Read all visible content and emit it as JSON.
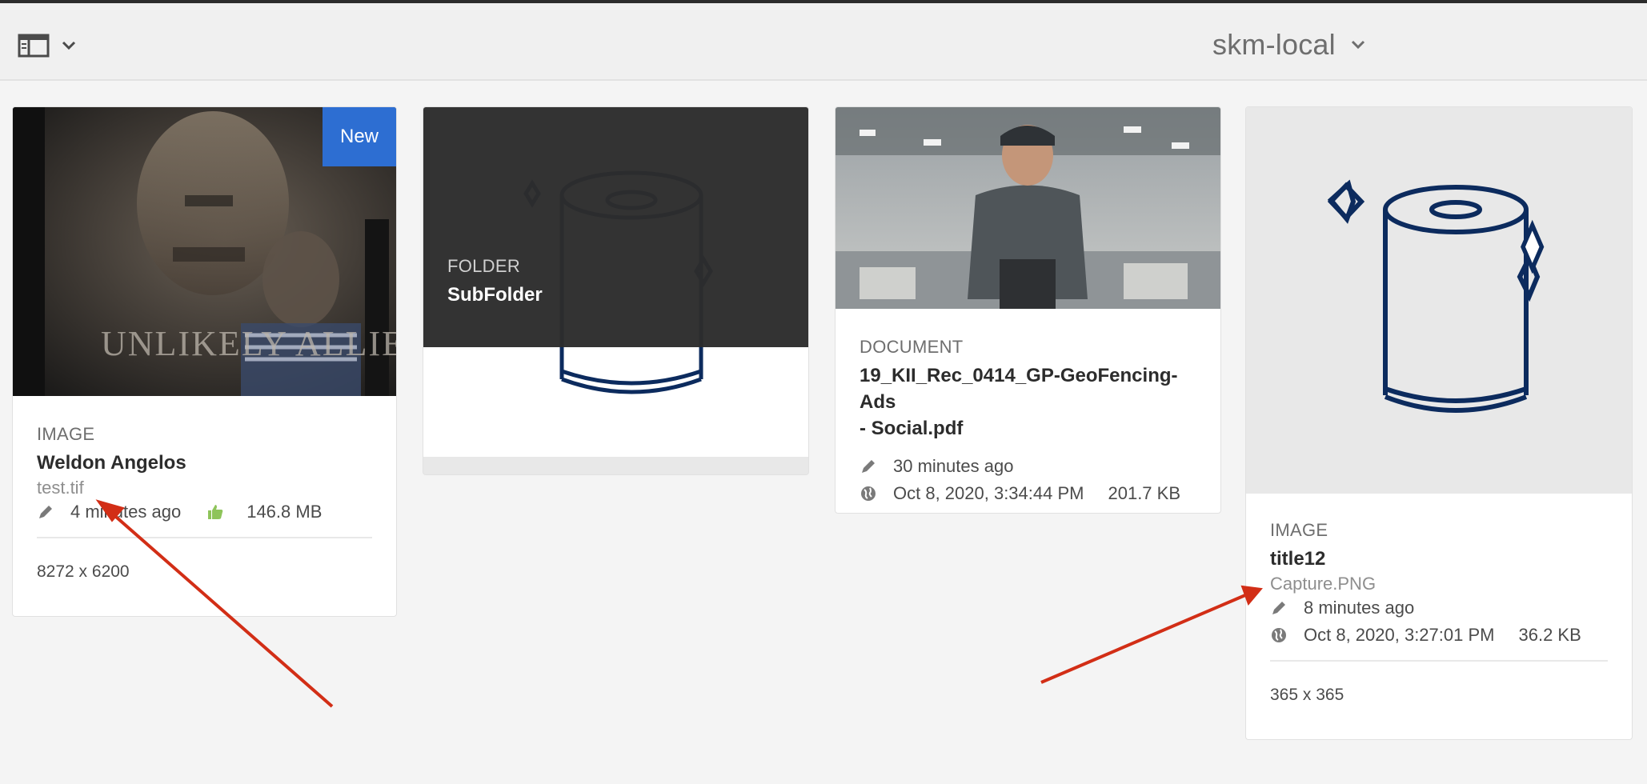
{
  "header": {
    "rail_icon": "rail-toggle-icon",
    "repo_name": "skm-local"
  },
  "cards": [
    {
      "badge": "New",
      "type": "IMAGE",
      "title": "Weldon Angelos",
      "file": "test.tif",
      "modified": "4 minutes ago",
      "size": "146.8 MB",
      "dimensions": "8272 x 6200",
      "thumbnail_text": "UNLIKELY ALLIES"
    },
    {
      "type": "FOLDER",
      "title": "SubFolder"
    },
    {
      "type": "DOCUMENT",
      "title_line1": "19_KII_Rec_0414_GP-GeoFencing-Ads",
      "title_line2": "- Social.pdf",
      "modified": "30 minutes ago",
      "published": "Oct 8, 2020, 3:34:44 PM",
      "size": "201.7 KB"
    },
    {
      "type": "IMAGE",
      "title": "title12",
      "file": "Capture.PNG",
      "modified": "8 minutes ago",
      "published": "Oct 8, 2020, 3:27:01 PM",
      "size": "36.2 KB",
      "dimensions": "365 x 365"
    }
  ],
  "colors": {
    "accent": "#2d6ed2",
    "annotation_arrow": "#d22e16",
    "approved": "#8ec45a",
    "asset_icon": "#0c2b5e"
  }
}
